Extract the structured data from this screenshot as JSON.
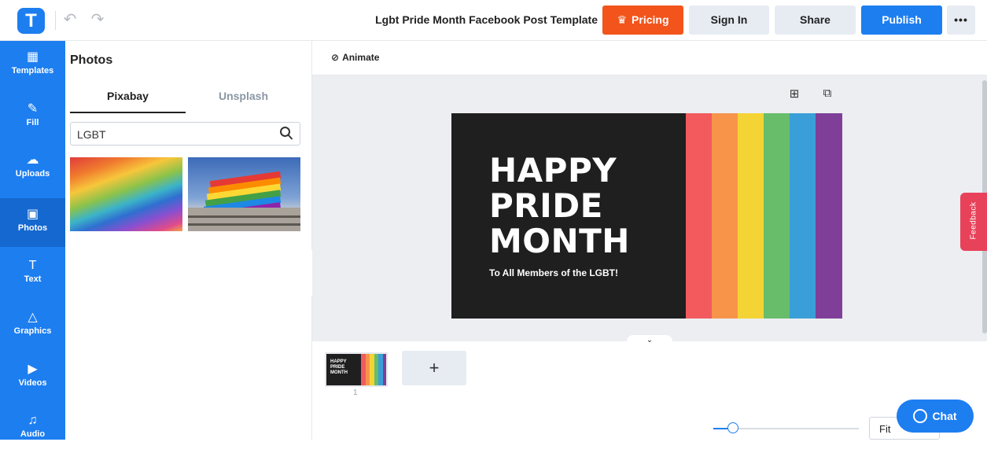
{
  "header": {
    "logo_letter": "T",
    "doc_title": "Lgbt Pride Month Facebook Post Template",
    "pricing_label": "Pricing",
    "signin_label": "Sign In",
    "share_label": "Share",
    "publish_label": "Publish",
    "more_label": "•••"
  },
  "sidebar": {
    "items": [
      {
        "label": "Templates",
        "icon": "templates-icon"
      },
      {
        "label": "Fill",
        "icon": "pencil-icon"
      },
      {
        "label": "Uploads",
        "icon": "cloud-upload-icon"
      },
      {
        "label": "Photos",
        "icon": "image-icon"
      },
      {
        "label": "Text",
        "icon": "text-icon"
      },
      {
        "label": "Graphics",
        "icon": "shapes-icon"
      },
      {
        "label": "Videos",
        "icon": "play-icon"
      },
      {
        "label": "Audio",
        "icon": "music-icon"
      }
    ],
    "active": "Photos"
  },
  "photos_panel": {
    "title": "Photos",
    "tabs": [
      "Pixabay",
      "Unsplash"
    ],
    "active_tab": "Pixabay",
    "search_value": "LGBT"
  },
  "toolbar": {
    "animate_label": "Animate"
  },
  "design": {
    "headline_lines": [
      "HAPPY",
      "PRIDE",
      "MONTH"
    ],
    "tagline": "To All Members of the LGBT!",
    "background": "#1f1f1f",
    "stripes": [
      "#f25a5e",
      "#f7944a",
      "#f4d434",
      "#68bd6b",
      "#3a9fd8",
      "#7f3f98"
    ]
  },
  "pages": {
    "thumb_lines": [
      "HAPPY",
      "PRIDE",
      "MONTH"
    ],
    "page_number": "1",
    "add_label": "+"
  },
  "zoom": {
    "fit_label": "Fit"
  },
  "chat_label": "Chat",
  "feedback_label": "Feedback",
  "colors": {
    "brand": "#1d7ef0",
    "pricing": "#f2541b",
    "feedback": "#e8425a"
  }
}
